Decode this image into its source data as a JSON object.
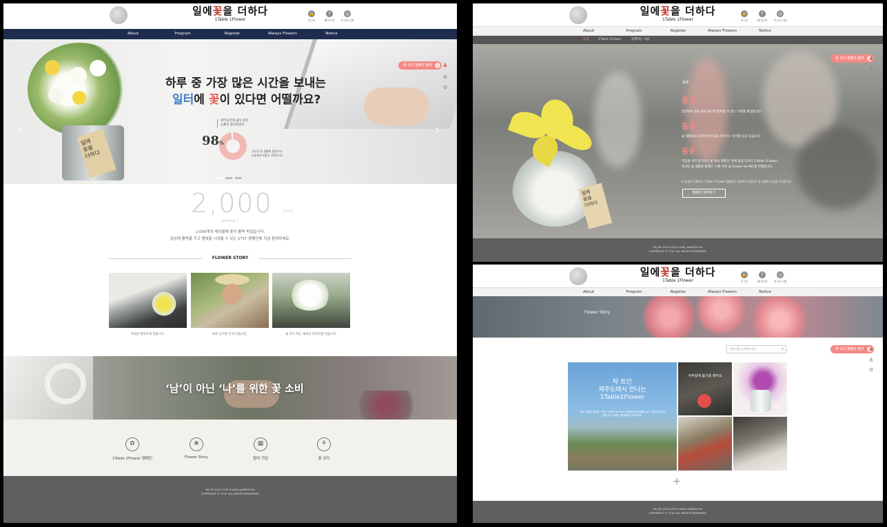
{
  "brand": {
    "name_kr": [
      "일에",
      "꽃",
      "을 더하다"
    ],
    "name_en": "1Table 1Flower"
  },
  "header_icons": [
    {
      "icon": "lock-icon",
      "label": "로그인",
      "glyph": "🔒"
    },
    {
      "icon": "facebook-icon",
      "label": "페이스북",
      "glyph": "f"
    },
    {
      "icon": "instagram-icon",
      "label": "인스타그램",
      "glyph": "◎"
    }
  ],
  "nav": [
    "About",
    "Program",
    "Register",
    "Always Flowers",
    "Notice"
  ],
  "subnav": [
    "동꽃",
    "1Table 1Flower",
    "함께하는 사람"
  ],
  "home": {
    "hero_line1": "하루 중 가장 많은 시간을 보내는",
    "hero_line2": {
      "a": "일터",
      "b": "에 ",
      "c": "꽃",
      "d": "이 있다면 어떨까요?"
    },
    "stat_caption": [
      "업무공간에 꽃이 있어",
      "능률이 향상되었다"
    ],
    "stat_value": "98",
    "stat_unit": "%",
    "stat_source": [
      "사무실 꽃 생활화 설문조사",
      "농림축산식품부, 2015.12"
    ],
    "campaign_pill": "꽃 코디 캠페인 참여",
    "big_number": "2,000",
    "big_unit": "Table",
    "big_sub": "참여 테이블 수",
    "desc1": "2,000개의 테이블에 꽃이 활짝 피었습니다.",
    "desc2": "일상에 활력을 주고 행복을 나눠줄 수 있는 1T1F 캠페인에 지금 참여하세요.",
    "story_title": "FLOWER STORY",
    "stories": [
      "직원을 행복하게 만듭니다.",
      "화원 농가를 웃게 만듭니다.",
      "꽃 코디 하는 새로운 일자리를 만듭니다."
    ],
    "banner_text": "‘남’이 아닌 ‘나’를 위한 꽃 소비",
    "quick_links": [
      {
        "icon": "bouquet-icon",
        "label": "1Table 1Flower 캠페인",
        "glyph": "✿"
      },
      {
        "icon": "flower-story-icon",
        "label": "Flower Story",
        "glyph": "❀"
      },
      {
        "icon": "company-icon",
        "label": "참여 기업",
        "glyph": "▦"
      },
      {
        "icon": "flower-coordi-icon",
        "label": "꽃 코디",
        "glyph": "⚘"
      }
    ]
  },
  "footer": {
    "line1": "Tel_00.2222.1234   E-mail_rodl@1t1f.kr",
    "line2": "COPYRIGHT © 1T1F. ALL RIGHTS RESERVED."
  },
  "about": {
    "label": "동꽃",
    "h1": "동꽃",
    "t1": "일상에서 쉽게 꽃을 즐기며 행복할 수 있는 기회를 제공합니다.",
    "h2": "동꽃",
    "t2": "꽃 생활화와 긍정적인 마음을 전한다는 의미를 담고 있습니다.",
    "h3": "동꽃",
    "t3a": "직장을 위한 정기적인 꽃 배송 캠페인 '일에 꽃을 더하다 1Table 1Flower',",
    "t3b": "대국민 꽃 생활화 캠페인 '나를 위한 꽃 Flower for Me'를 진행합니다.",
    "note": "※ 동꽃이 진행하는 1Table 1Flower 캠페인은 농림축산식품부가 꽃 생활화 사업을 추진합니다.",
    "button": "캠페인 참여하기"
  },
  "flower_story": {
    "hero_title": "Flower Story",
    "search_placeholder": "검색어를 입력해주세요",
    "feature_title": [
      "탁 트인",
      "제주도에서 만나는",
      "1Table1Flower"
    ],
    "feature_text": "제주 지역에 위치한 기업이 1Table 1Flower 캠페인에 참여했습니다. 사무실 곳곳에 꽃을 두고 일하는 즐거움을 느껴보세요.",
    "office_title": [
      "사무실에 봄기를 찾아요"
    ],
    "more": "+"
  }
}
